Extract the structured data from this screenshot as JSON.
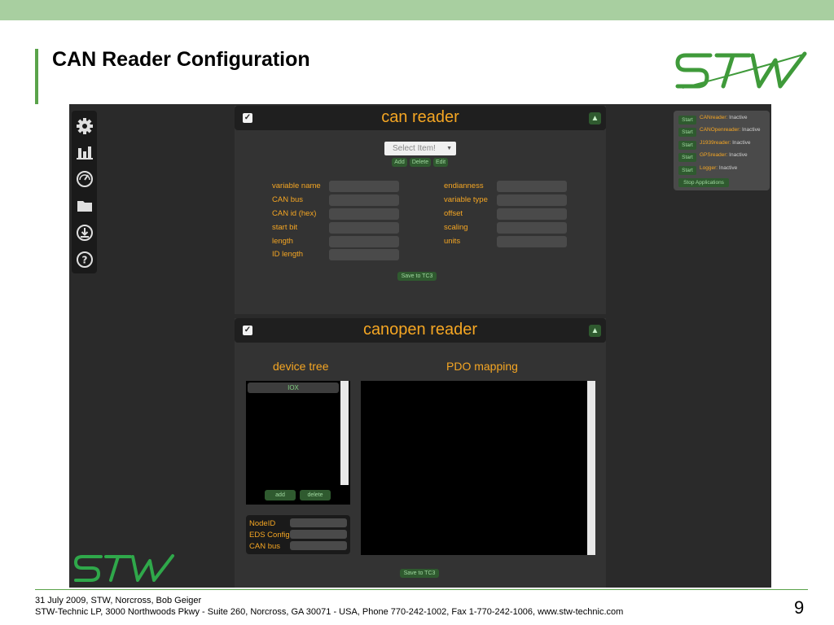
{
  "slide": {
    "title": "CAN Reader Configuration",
    "footer_line1": "31 July 2009, STW, Norcross, Bob Geiger",
    "footer_line2": "STW-Technic LP, 3000 Northwoods Pkwy - Suite 260, Norcross, GA 30071 - USA, Phone 770-242-1002, Fax 1-770-242-1006, www.stw-technic.com",
    "page_number": "9",
    "accent_color": "#5aa34a",
    "band_color": "#a8cfa0"
  },
  "toolbar": {
    "icons": [
      "gear-icon",
      "bar-chart-icon",
      "gauge-icon",
      "folder-icon",
      "download-icon",
      "help-icon"
    ]
  },
  "can_reader": {
    "title": "can reader",
    "select_placeholder": "Select Item!",
    "add_label": "Add",
    "delete_label": "Delete",
    "edit_label": "Edit",
    "left_fields": [
      "variable name",
      "CAN bus",
      "CAN id (hex)",
      "start bit",
      "length",
      "ID length"
    ],
    "right_fields": [
      "endianness",
      "variable type",
      "offset",
      "scaling",
      "units"
    ],
    "save_label": "Save to TC3"
  },
  "canopen_reader": {
    "title": "canopen reader",
    "device_tree_title": "device tree",
    "pdo_mapping_title": "PDO mapping",
    "device_items": [
      "IOX"
    ],
    "add_label": "add",
    "delete_label": "delete",
    "node_fields": [
      "NodeID",
      "EDS Config",
      "CAN bus"
    ],
    "save_label": "Save to TC3"
  },
  "status": {
    "start_label": "Start",
    "apps": [
      {
        "name": "CANreader",
        "state": "Inactive"
      },
      {
        "name": "CANOpenreader",
        "state": "Inactive"
      },
      {
        "name": "J1939reader",
        "state": "Inactive"
      },
      {
        "name": "GPSreader",
        "state": "Inactive"
      },
      {
        "name": "Logger",
        "state": "Inactive"
      }
    ],
    "stop_label": "Stop Applications"
  }
}
